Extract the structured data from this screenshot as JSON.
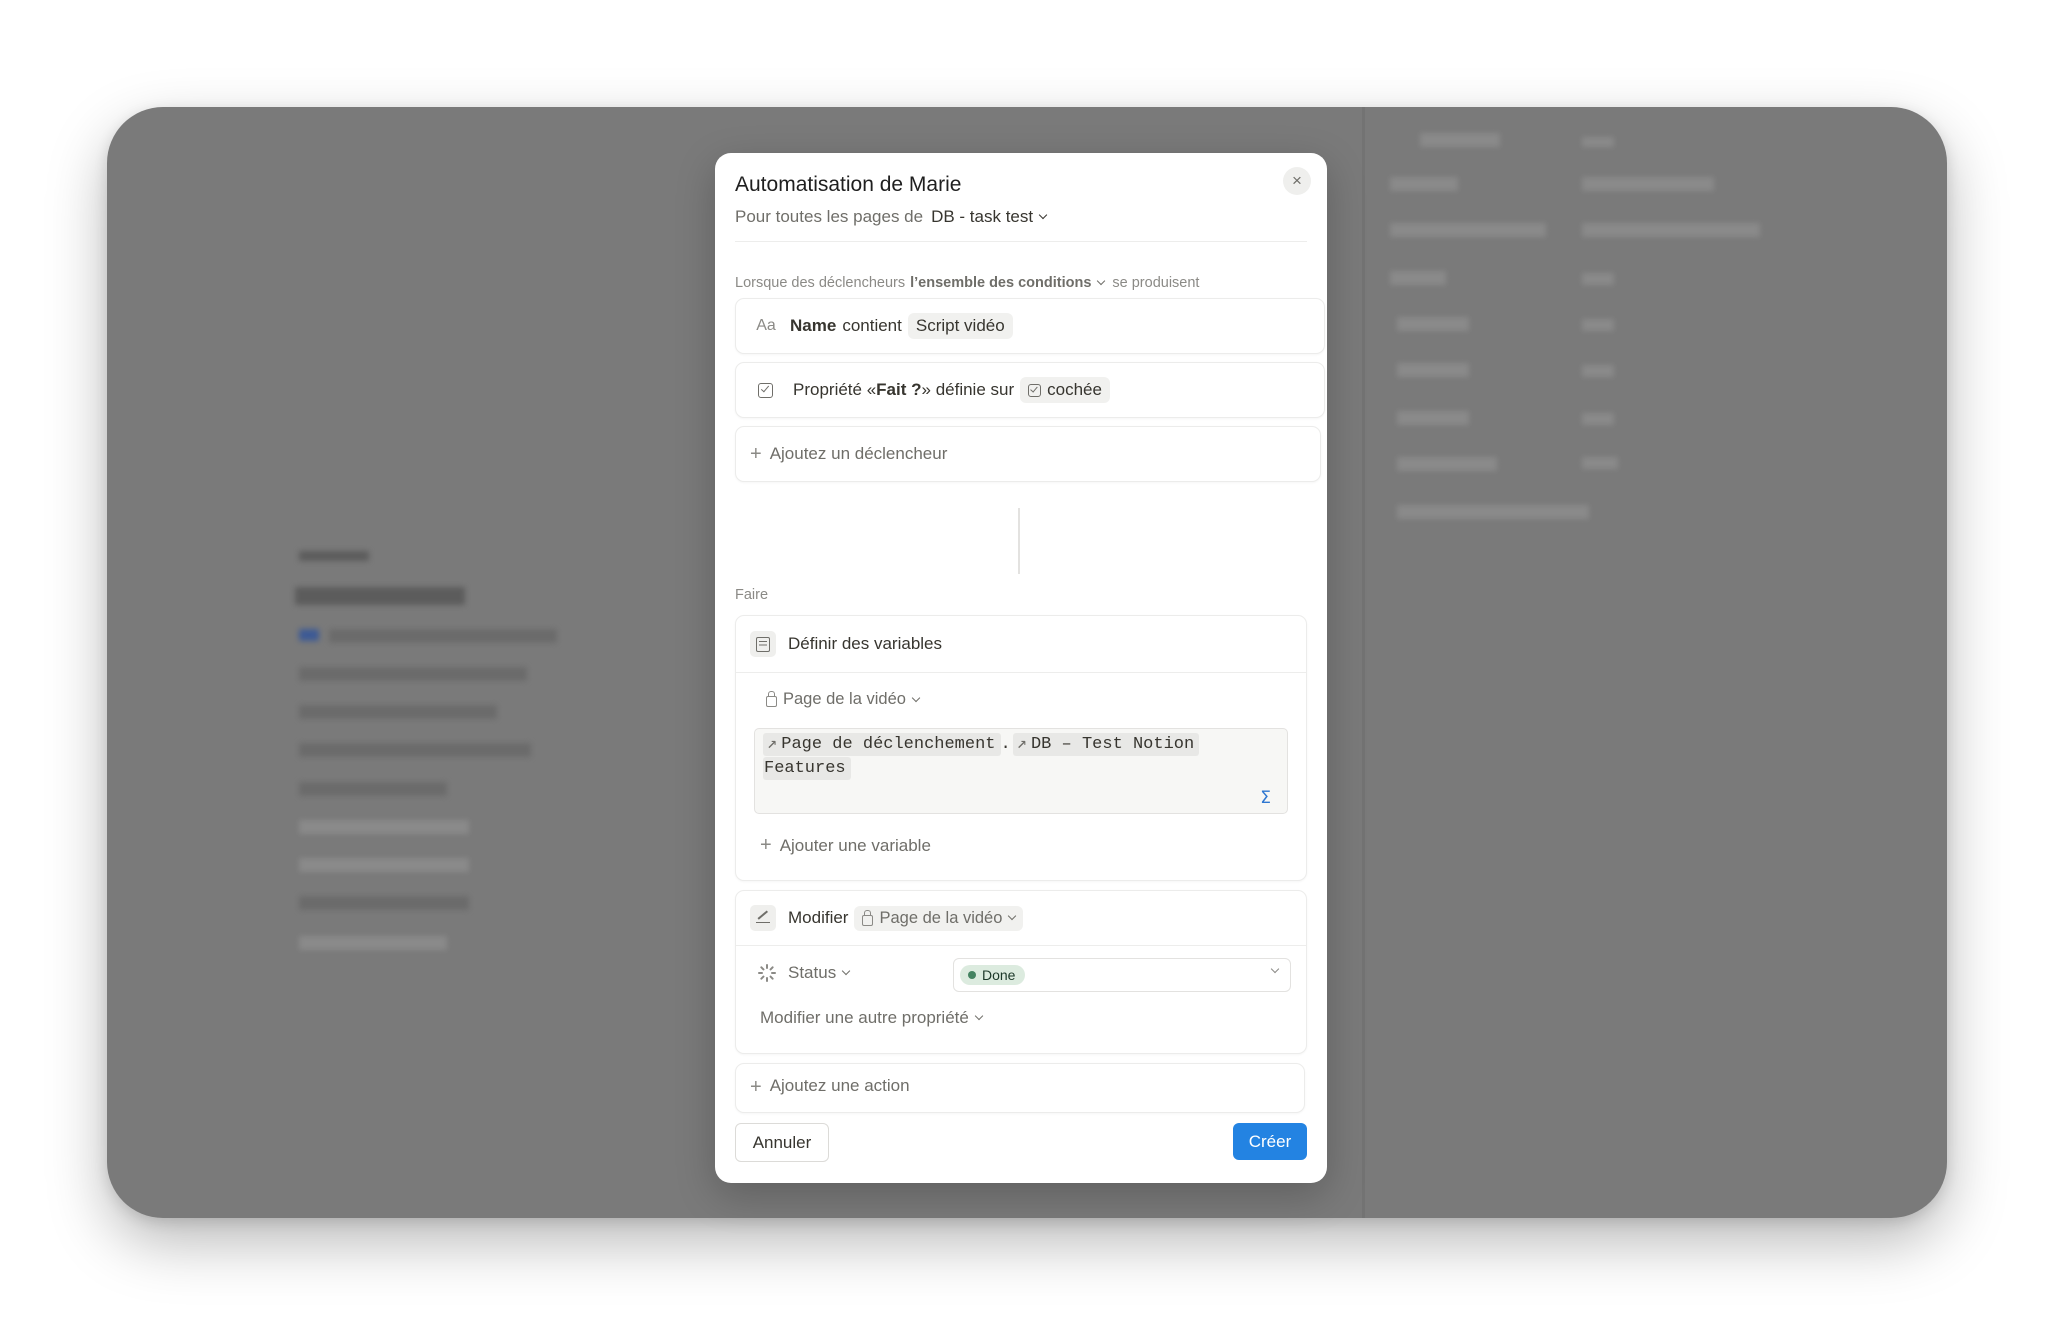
{
  "modal": {
    "title": "Automatisation de Marie",
    "subtitle_prefix": "Pour toutes les pages de",
    "database": "DB - task test",
    "condition_line": {
      "prefix": "Lorsque des déclencheurs",
      "mode": "l’ensemble des conditions",
      "suffix": "se produisent"
    },
    "triggers": [
      {
        "icon": "Aa",
        "field": "Name",
        "operator": "contient",
        "value": "Script vidéo"
      },
      {
        "icon": "checkbox-icon",
        "text_pre": "Propriété « ",
        "field": "Fait ?",
        "text_post": " » définie sur",
        "value": "cochée"
      }
    ],
    "add_trigger_label": "Ajoutez un déclencheur",
    "do_label": "Faire",
    "actions": {
      "define_variables": {
        "label": "Définir des variables",
        "variable_name": "Page de la vidéo",
        "formula_tokens": [
          "Page de déclenchement",
          "DB – Test Notion",
          "Features"
        ],
        "formula_dot": ".",
        "sigma": "Σ",
        "add_variable_label": "Ajouter une variable"
      },
      "modify": {
        "label": "Modifier",
        "target": "Page de la vidéo",
        "property_name": "Status",
        "property_value": "Done",
        "other_property_label": "Modifier une autre propriété"
      }
    },
    "add_action_label": "Ajoutez une action",
    "buttons": {
      "cancel": "Annuler",
      "create": "Créer"
    }
  },
  "icons": {
    "close": "×",
    "plus": "+",
    "arrow": "↗"
  },
  "colors": {
    "accent": "#2383e2",
    "done_badge_bg": "#dcebdf",
    "done_dot": "#448361",
    "overlay": "#7a7a7a"
  }
}
